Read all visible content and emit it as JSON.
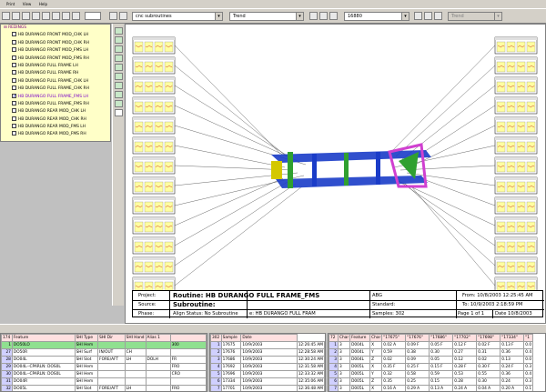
{
  "menu": {
    "items": [
      "Print",
      "View",
      "Help"
    ]
  },
  "toolbar": {
    "subroutine_combo": "cnc subroutines",
    "view_combo": "Trend",
    "sample_combo": "16880",
    "range_combo": "Trend"
  },
  "tree": {
    "root": "REDINGS",
    "items": [
      {
        "label": "HB DURANGO FRONT MOD_CHK LH",
        "checked": false
      },
      {
        "label": "HB DURANGO FRONT MOD_CHK RH",
        "checked": false
      },
      {
        "label": "HB DURANGO FRONT MOD_FMS LH",
        "checked": false
      },
      {
        "label": "HB DURANGO FRONT MOD_FMS RH",
        "checked": false
      },
      {
        "label": "HB DURANGO FULL FRAME LH",
        "checked": false
      },
      {
        "label": "HB DURANGO FULL FRAME RH",
        "checked": false
      },
      {
        "label": "HB DURANGO FULL FRAME_CHK LH",
        "checked": false
      },
      {
        "label": "HB DURANGO FULL FRAME_CHK RH",
        "checked": false
      },
      {
        "label": "HB DURANGO FULL FRAME_FMS LH",
        "checked": true
      },
      {
        "label": "HB DURANGO FULL FRAME_FMS RH",
        "checked": false
      },
      {
        "label": "HB DURANGO REAR MOD_CHK LH",
        "checked": false
      },
      {
        "label": "HB DURANGO REAR MOD_CHK RH",
        "checked": false
      },
      {
        "label": "HB DURANGO REAR MOD_FMS LH",
        "checked": false
      },
      {
        "label": "HB DURANGO REAR MOD_FMS RH",
        "checked": false
      }
    ]
  },
  "info": {
    "project_label": "Project:",
    "routine": "Routine: HB DURANGO FULL FRAME_FMS",
    "source_label": "Source:",
    "subroutine": "Subroutine:",
    "phase_label": "Phase:",
    "align_status": "Align Status: No Subroutine",
    "file": "e: HB DURANGO FULL FRAM",
    "abs": "ABG",
    "standard": "Standard:",
    "samples": "Samples: 302",
    "from": "From: 10/8/2003 12:25:45 AM",
    "to": "To: 10/9/2003 2:18:59 PM",
    "page": "Page 1 of 1",
    "date": "Date 10/8/2003"
  },
  "feature_table": {
    "headers": [
      "174",
      "Feature",
      "SHI Type",
      "SHI Dir",
      "SHI Hand",
      "Alias 1",
      ""
    ],
    "rows": [
      [
        "1",
        "DO50LO",
        "SHI Hem",
        "",
        "",
        "",
        "300"
      ],
      [
        "27",
        "DO50R",
        "SHI Surf",
        "IN/OUT",
        "CH",
        "",
        ""
      ],
      [
        "28",
        "DO04L",
        "SHI Slot",
        "FORE/AFT",
        "LH",
        "DOLH",
        "FR"
      ],
      [
        "29",
        "DO04L--CPARLN: DOS0L",
        "SHI Hem",
        "",
        "",
        "",
        "FRO"
      ],
      [
        "30",
        "DO04L--CPARLN: DOS0L",
        "SHI Hem",
        "",
        "",
        "",
        "CRO"
      ],
      [
        "31",
        "DO04R",
        "SHI Hem",
        "",
        "",
        "",
        ""
      ],
      [
        "32",
        "DO05L",
        "SHI Slot",
        "FORE/AFT",
        "LH",
        "",
        "FRO"
      ]
    ]
  },
  "sample_table": {
    "headers": [
      "302",
      "Sample",
      "Date"
    ],
    "rows": [
      [
        "1",
        "17675",
        "10/9/2003",
        "12:26:45 AM"
      ],
      [
        "2",
        "17676",
        "10/9/2003",
        "12:28:58 AM"
      ],
      [
        "3",
        "17686",
        "10/9/2003",
        "12:30:24 AM"
      ],
      [
        "4",
        "17692",
        "10/9/2003",
        "12:31:58 AM"
      ],
      [
        "5",
        "17696",
        "10/9/2003",
        "12:33:32 AM"
      ],
      [
        "6",
        "17334",
        "10/9/2003",
        "12:35:06 AM"
      ],
      [
        "7",
        "17701",
        "10/9/2003",
        "12:36:48 AM"
      ]
    ]
  },
  "char_table": {
    "headers": [
      "72",
      "Char",
      "Feature",
      "Char",
      "\"17675\"",
      "\"17676\"",
      "\"17686\"",
      "\"17702\"",
      "\"17698\"",
      "\"17334\"",
      "\"1"
    ],
    "rows": [
      [
        "1",
        "3",
        "D004L",
        "X",
        "0.02 A",
        "0.09 F",
        "0.05 F",
        "0.12 F",
        "0.02 F",
        "0.13 F",
        "0.0"
      ],
      [
        "2",
        "3",
        "D004L",
        "Y",
        "0.59",
        "0.38",
        "0.30",
        "0.27",
        "0.31",
        "0.36",
        "0.4"
      ],
      [
        "3",
        "3",
        "D004L",
        "Z",
        "0.02",
        "0.09",
        "0.05",
        "0.12",
        "0.02",
        "0.13",
        "0.0"
      ],
      [
        "4",
        "3",
        "D005L",
        "X",
        "0.35 F",
        "0.25 F",
        "0.15 F",
        "0.28 F",
        "0.30 F",
        "0.24 F",
        "0.3"
      ],
      [
        "5",
        "3",
        "D005L",
        "Y",
        "0.32",
        "0.58",
        "0.59",
        "0.53",
        "0.55",
        "0.36",
        "0.4"
      ],
      [
        "6",
        "3",
        "D005L",
        "Z",
        "0.35",
        "0.25",
        "0.15",
        "0.28",
        "0.30",
        "0.24",
        "0.3"
      ],
      [
        "7",
        "3",
        "D005L",
        "X",
        "0.16 A",
        "0.29 A",
        "0.13 A",
        "0.24 A",
        "0.04 A",
        "0.20 A",
        "0.1"
      ]
    ]
  },
  "colors": {
    "tree_bg": "#ffffc8",
    "frame_blue": "#1a3cc8",
    "frame_green": "#30a030",
    "frame_magenta": "#d040d0",
    "header_pink": "#ffe0e0"
  }
}
